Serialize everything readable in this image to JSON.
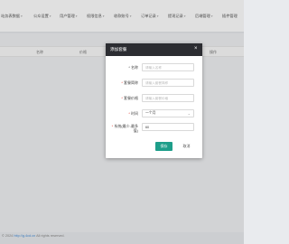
{
  "topnav": {
    "items": [
      {
        "label": "站务表数据"
      },
      {
        "label": "公众设置"
      },
      {
        "label": "用户管理"
      },
      {
        "label": "权限信息"
      },
      {
        "label": "收款账号"
      },
      {
        "label": "订单记录"
      },
      {
        "label": "提现记录"
      },
      {
        "label": "后端管理"
      },
      {
        "label": "插件管理"
      }
    ]
  },
  "table": {
    "headers": [
      "名称",
      "价格",
      "操作"
    ]
  },
  "modal": {
    "title": "添加套餐",
    "fields": [
      {
        "label": "名称",
        "required": false,
        "placeholder": "请输入名称",
        "value": ""
      },
      {
        "label": "套餐简称",
        "required": true,
        "placeholder": "请输入套餐简称",
        "value": ""
      },
      {
        "label": "套餐价格",
        "required": true,
        "placeholder": "请输入套餐价格",
        "value": ""
      },
      {
        "label": "时间",
        "required": true,
        "value": "一个月"
      },
      {
        "label": "系统(最少-最多值)",
        "required": true,
        "placeholder": "",
        "value": "60"
      }
    ],
    "save_label": "保存",
    "cancel_label": "取消"
  },
  "footer": {
    "prefix": "© 2024",
    "link": "http://g.4cd.cn",
    "suffix": "All rights reserved."
  }
}
